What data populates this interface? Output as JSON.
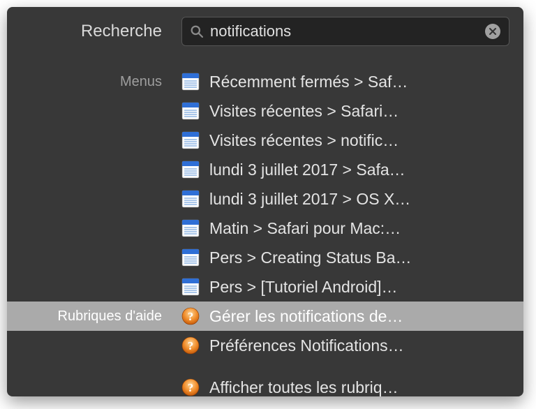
{
  "search": {
    "label": "Recherche",
    "value": "notifications"
  },
  "sections": {
    "menus_label": "Menus",
    "help_label": "Rubriques d'aide"
  },
  "menu_items": [
    "Récemment fermés > Saf…",
    "Visites récentes > Safari…",
    "Visites récentes > notific…",
    "lundi 3 juillet 2017 > Safa…",
    "lundi 3 juillet 2017 > OS X…",
    "Matin > Safari pour Mac:…",
    "Pers > Creating Status Ba…",
    "Pers > [Tutoriel Android]…"
  ],
  "help_items": [
    "Gérer les notifications de…",
    "Préférences Notifications…"
  ],
  "show_all": "Afficher toutes les rubriq…"
}
